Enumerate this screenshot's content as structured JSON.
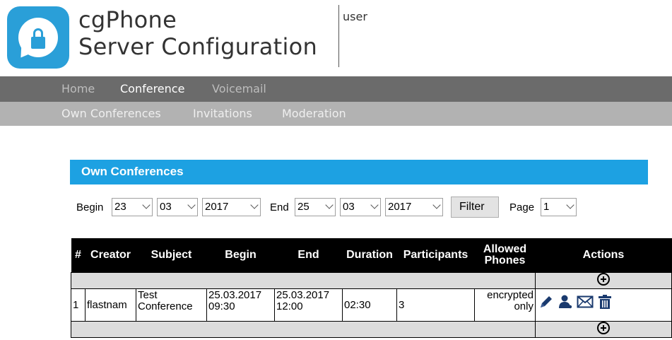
{
  "header": {
    "title_line1": "cgPhone",
    "title_line2": "Server Configuration",
    "user": "user"
  },
  "nav": {
    "main": [
      "Home",
      "Conference",
      "Voicemail"
    ],
    "sub": [
      "Own Conferences",
      "Invitations",
      "Moderation"
    ],
    "active_main": "Conference"
  },
  "section": {
    "title": "Own Conferences"
  },
  "filter": {
    "begin_label": "Begin",
    "begin_day": "23",
    "begin_month": "03",
    "begin_year": "2017",
    "end_label": "End",
    "end_day": "25",
    "end_month": "03",
    "end_year": "2017",
    "filter_button": "Filter",
    "page_label": "Page",
    "page_value": "1"
  },
  "table": {
    "headers": [
      "#",
      "Creator",
      "Subject",
      "Begin",
      "End",
      "Duration",
      "Participants",
      "Allowed Phones",
      "Actions"
    ],
    "rows": [
      {
        "num": "1",
        "creator": "flastnam",
        "subject": "Test Conference",
        "begin": "25.03.2017 09:30",
        "end": "25.03.2017 12:00",
        "duration": "02:30",
        "participants": "3",
        "allowed_phones": "encrypted only"
      }
    ],
    "action_icons": [
      "edit-icon",
      "user-icon",
      "mail-icon",
      "trash-icon"
    ]
  },
  "colors": {
    "accent": "#1da1e2",
    "nav_dark": "#6b6b6b",
    "nav_light": "#b2b2b2"
  }
}
